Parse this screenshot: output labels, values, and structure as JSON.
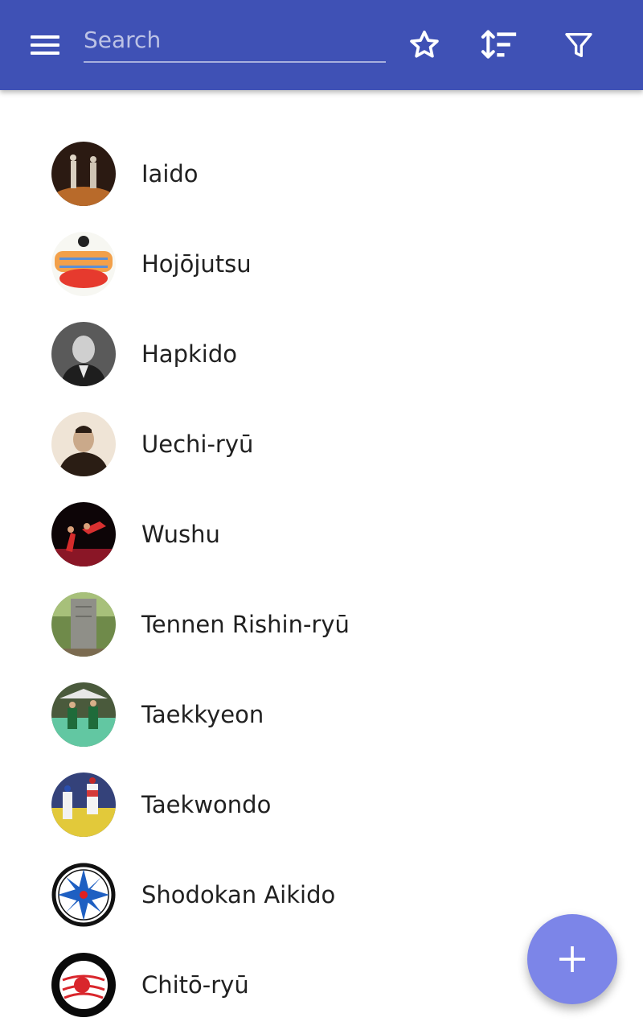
{
  "toolbar": {
    "menu_icon": "menu-icon",
    "search_placeholder": "Search",
    "search_value": "",
    "favorites_icon": "star-outline-icon",
    "sort_icon": "sort-icon",
    "filter_icon": "filter-icon",
    "background_color": "#3f51b5"
  },
  "list": {
    "items": [
      {
        "label": "Iaido"
      },
      {
        "label": "Hojōjutsu"
      },
      {
        "label": "Hapkido"
      },
      {
        "label": "Uechi-ryū"
      },
      {
        "label": "Wushu"
      },
      {
        "label": "Tennen Rishin-ryū"
      },
      {
        "label": "Taekkyeon"
      },
      {
        "label": "Taekwondo"
      },
      {
        "label": "Shodokan Aikido"
      },
      {
        "label": "Chitō-ryū"
      }
    ]
  },
  "fab": {
    "icon": "plus-icon",
    "color": "#7c85e8"
  }
}
